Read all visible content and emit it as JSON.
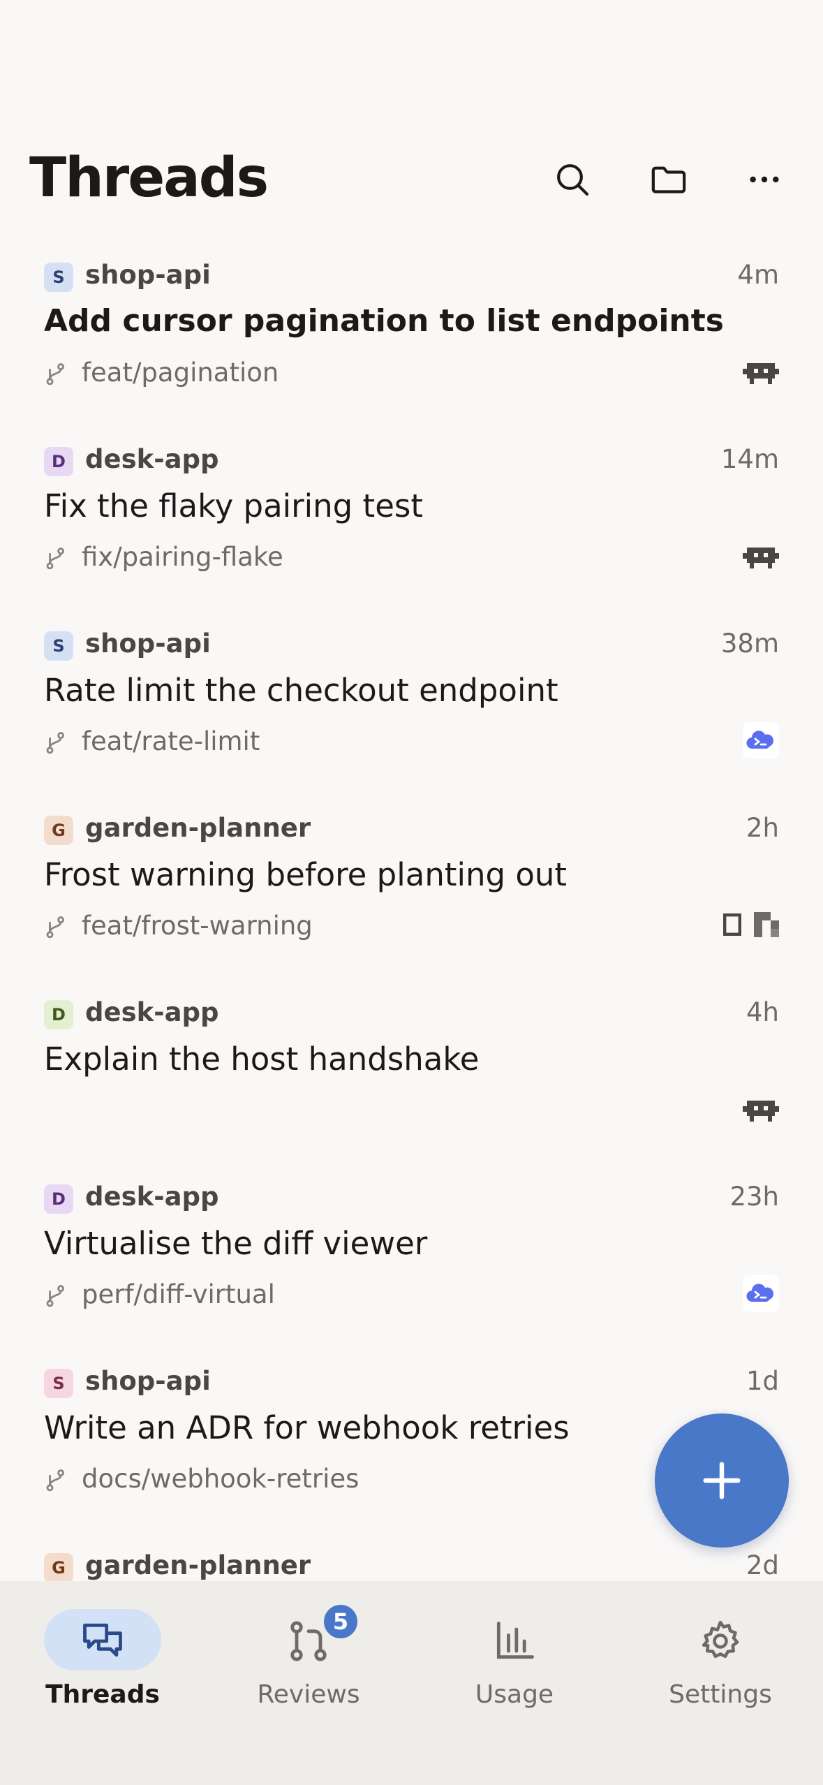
{
  "header": {
    "title": "Threads",
    "actions": [
      "search-icon",
      "folder-icon",
      "more-icon"
    ]
  },
  "threads": [
    {
      "repo_initial": "S",
      "repo": "shop-api",
      "time": "4m",
      "title": "Add cursor pagination to list endpoints",
      "branch": "feat/pagination",
      "unread": true,
      "agents": [
        "robot-agent-icon"
      ],
      "badge_bg": "#d6e0f5",
      "badge_fg": "#2d3f73"
    },
    {
      "repo_initial": "D",
      "repo": "desk-app",
      "time": "14m",
      "title": "Fix the flaky pairing test",
      "branch": "fix/pairing-flake",
      "unread": false,
      "agents": [
        "robot-agent-icon"
      ],
      "badge_bg": "#e7d8f3",
      "badge_fg": "#5b2d7a"
    },
    {
      "repo_initial": "S",
      "repo": "shop-api",
      "time": "38m",
      "title": "Rate limit the checkout endpoint",
      "branch": "feat/rate-limit",
      "unread": false,
      "agents": [
        "cloud-agent-icon"
      ],
      "badge_bg": "#d6e0f5",
      "badge_fg": "#2d3f73"
    },
    {
      "repo_initial": "G",
      "repo": "garden-planner",
      "time": "2h",
      "title": "Frost warning before planting out",
      "branch": "feat/frost-warning",
      "unread": false,
      "agents": [
        "square-agent-icon",
        "pixel-agent-icon"
      ],
      "badge_bg": "#f4dccd",
      "badge_fg": "#6e3a1e"
    },
    {
      "repo_initial": "D",
      "repo": "desk-app",
      "time": "4h",
      "title": "Explain the host handshake",
      "branch": "",
      "unread": false,
      "agents": [
        "robot-agent-icon"
      ],
      "badge_bg": "#e2efd0",
      "badge_fg": "#3e5a1f"
    },
    {
      "repo_initial": "D",
      "repo": "desk-app",
      "time": "23h",
      "title": "Virtualise the diff viewer",
      "branch": "perf/diff-virtual",
      "unread": false,
      "agents": [
        "cloud-agent-icon"
      ],
      "badge_bg": "#e7d8f3",
      "badge_fg": "#5b2d7a"
    },
    {
      "repo_initial": "S",
      "repo": "shop-api",
      "time": "1d",
      "title": "Write an ADR for webhook retries",
      "branch": "docs/webhook-retries",
      "unread": false,
      "agents": [],
      "badge_bg": "#f6d6e0",
      "badge_fg": "#7a2d45"
    },
    {
      "repo_initial": "G",
      "repo": "garden-planner",
      "time": "2d",
      "title": "",
      "branch": "",
      "unread": false,
      "agents": [],
      "badge_bg": "#f4dccd",
      "badge_fg": "#6e3a1e"
    }
  ],
  "fab": {
    "icon": "plus-icon"
  },
  "tabs": [
    {
      "label": "Threads",
      "icon": "chat-bubbles-icon",
      "active": true
    },
    {
      "label": "Reviews",
      "icon": "git-pull-request-icon",
      "active": false,
      "badge": "5"
    },
    {
      "label": "Usage",
      "icon": "bar-chart-icon",
      "active": false
    },
    {
      "label": "Settings",
      "icon": "gear-icon",
      "active": false
    }
  ],
  "colors": {
    "accent": "#4a78c8",
    "tab_active_bg": "#d3e1f7",
    "background": "#faf8f7"
  }
}
